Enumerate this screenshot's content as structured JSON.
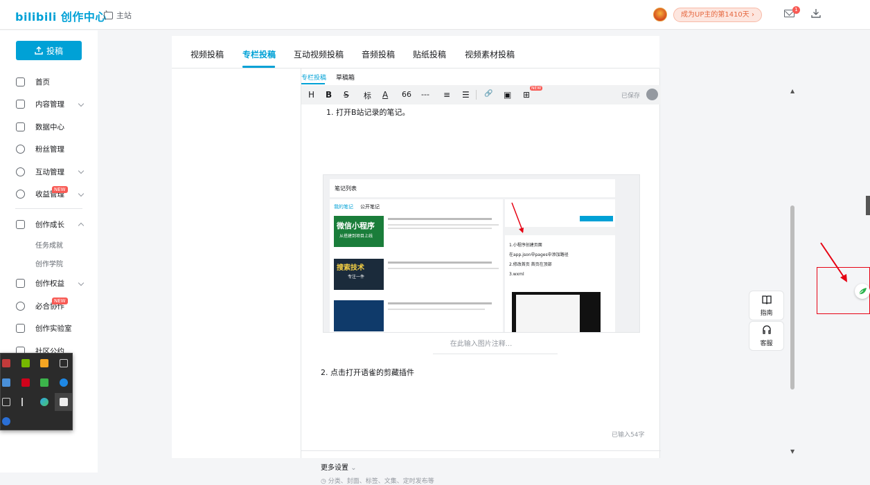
{
  "header": {
    "logo_text": "bilibili",
    "logo_suffix": "创作中心",
    "home_link": "主站",
    "up_badge": "成为UP主的第1410天",
    "mail_count": "1"
  },
  "sidebar": {
    "upload_label": "投稿",
    "items": [
      {
        "label": "首页"
      },
      {
        "label": "内容管理"
      },
      {
        "label": "数据中心"
      },
      {
        "label": "粉丝管理"
      },
      {
        "label": "互动管理"
      },
      {
        "label": "收益管理",
        "tag": "NEW"
      },
      {
        "label": "创作成长"
      },
      {
        "label": "任务成就"
      },
      {
        "label": "创作学院"
      },
      {
        "label": "创作权益"
      },
      {
        "label": "必合协作",
        "tag": "NEW"
      },
      {
        "label": "创作实验室"
      },
      {
        "label": "社区公约"
      }
    ]
  },
  "tabs": [
    {
      "label": "视频投稿"
    },
    {
      "label": "专栏投稿"
    },
    {
      "label": "互动视频投稿"
    },
    {
      "label": "音频投稿"
    },
    {
      "label": "贴纸投稿"
    },
    {
      "label": "视频素材投稿"
    }
  ],
  "editor": {
    "subtabs": [
      "专栏投稿",
      "草稿箱"
    ],
    "toolbar": [
      "H",
      "B",
      "S",
      "标",
      "A",
      "66",
      "---",
      "≡",
      "☰",
      "🔗",
      "▣",
      "⊞"
    ],
    "toolbar_new": "NEW",
    "saved_label": "已保存",
    "line1": "1. 打开B站记录的笔记。",
    "caption_placeholder": "在此输入图片注释...",
    "line2": "2. 点击打开语雀的剪藏插件",
    "word_count": "已输入54字",
    "more_settings": "更多设置",
    "more_hint": "分类、封面、标签、文集、定时发布等"
  },
  "embedded_screenshot": {
    "header": "笔记列表",
    "tabs": [
      "我的笔记",
      "公开笔记"
    ],
    "cards": [
      {
        "title": "微信小程序",
        "subtitle": "从搭建到项目上线"
      },
      {
        "title": "搜索技术",
        "subtitle": "专注一件"
      }
    ],
    "right_lines": [
      "1.小程序创建页面",
      "在app.json中pages中添加路径",
      "2.修改首页 首页在顶部",
      "3.wxml"
    ]
  },
  "float": {
    "guide": "指南",
    "service": "客服"
  }
}
